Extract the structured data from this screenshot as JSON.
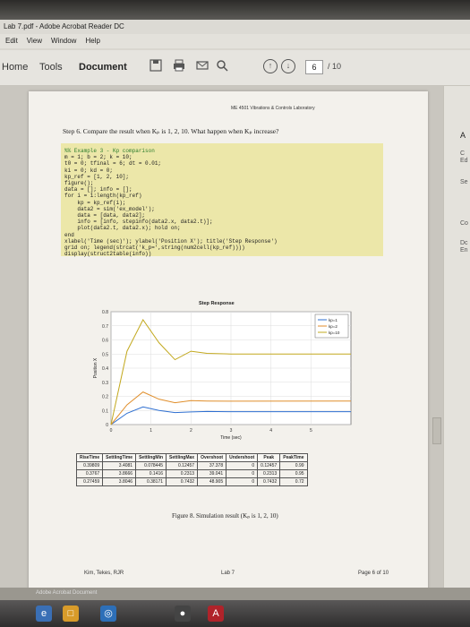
{
  "window": {
    "title": "Lab 7.pdf - Adobe Acrobat Reader DC"
  },
  "menu": {
    "items": [
      "Edit",
      "View",
      "Window",
      "Help"
    ]
  },
  "toolbar": {
    "tabs": [
      "Home",
      "Tools",
      "Document"
    ],
    "page_current": "6",
    "page_total": "/ 10",
    "icons": [
      "save-icon",
      "print-icon",
      "email-icon",
      "search-icon",
      "page-up-icon",
      "page-down-icon"
    ]
  },
  "right_panel": {
    "items": [
      "A",
      "C",
      "Ed",
      "Se",
      "Co",
      "Dc",
      "En"
    ]
  },
  "document": {
    "header": "ME 4501 Vibrations & Controls Laboratory",
    "step": "Step 6. Compare the result when Kₚ is 1, 2, 10. What happen when Kₚ increase?",
    "code_lines": [
      "%% Example 3 - Kp comparison",
      "m = 1; b = 2; k = 10;",
      "t0 = 0; tfinal = 6; dt = 0.01;",
      "ki = 0; kd = 0;",
      "kp_ref = [1, 2, 10];",
      "figure();",
      "data = []; info = [];",
      "for i = 1:length(kp_ref)",
      "    kp = kp_ref(i);",
      "    data2 = sim('ex_model');",
      "    data = [data, data2];",
      "    info = [info, stepinfo(data2.x, data2.t)];",
      "    plot(data2.t, data2.x); hold on;",
      "end",
      "xlabel('Time (sec)'); ylabel('Position X'); title('Step Response')",
      "grid on; legend(strcat('k_p=',string(num2cell(kp_ref))))",
      "display(struct2table(info))"
    ],
    "table": {
      "headers": [
        "RiseTime",
        "SettlingTime",
        "SettlingMin",
        "SettlingMax",
        "Overshoot",
        "Undershoot",
        "Peak",
        "PeakTime"
      ],
      "rows": [
        [
          "0.39809",
          "3.4081",
          "0.078445",
          "0.12457",
          "37.378",
          "0",
          "0.12457",
          "0.99"
        ],
        [
          "0.3767",
          "3.8666",
          "0.1416",
          "0.2313",
          "39.041",
          "0",
          "0.2313",
          "0.95"
        ],
        [
          "0.27459",
          "3.8046",
          "0.38171",
          "0.7432",
          "48.905",
          "0",
          "0.7432",
          "0.72"
        ]
      ]
    },
    "caption": "Figure 8. Simulation result (Kₚ is 1, 2, 10)",
    "footer": {
      "left": "Kim, Tekes, RJR",
      "middle": "Lab 7",
      "right": "Page 6 of 10"
    }
  },
  "status_bar": {
    "text": "Adobe Acrobat Document"
  },
  "chart_data": {
    "type": "line",
    "title": "Step Response",
    "xlabel": "Time (sec)",
    "ylabel": "Position X",
    "xlim": [
      0,
      6
    ],
    "ylim": [
      0,
      0.8
    ],
    "xticks": [
      0,
      1,
      2,
      3,
      4,
      5
    ],
    "yticks": [
      0,
      0.1,
      0.2,
      0.3,
      0.4,
      0.5,
      0.6,
      0.7,
      0.8
    ],
    "grid": true,
    "legend": "top-right",
    "series": [
      {
        "name": "kp=1",
        "color": "#2e6fd1",
        "values": [
          0,
          0.08,
          0.125,
          0.1,
          0.085,
          0.09,
          0.093,
          0.091,
          0.0915
        ]
      },
      {
        "name": "kp=2",
        "color": "#e08e2b",
        "values": [
          0,
          0.14,
          0.231,
          0.18,
          0.155,
          0.17,
          0.167,
          0.166,
          0.1665
        ]
      },
      {
        "name": "kp=10",
        "color": "#c2a81d",
        "values": [
          0,
          0.52,
          0.743,
          0.58,
          0.46,
          0.52,
          0.505,
          0.5,
          0.5
        ]
      }
    ],
    "x": [
      0,
      0.4,
      0.8,
      1.2,
      1.6,
      2.0,
      2.4,
      3.0,
      6.0
    ]
  }
}
